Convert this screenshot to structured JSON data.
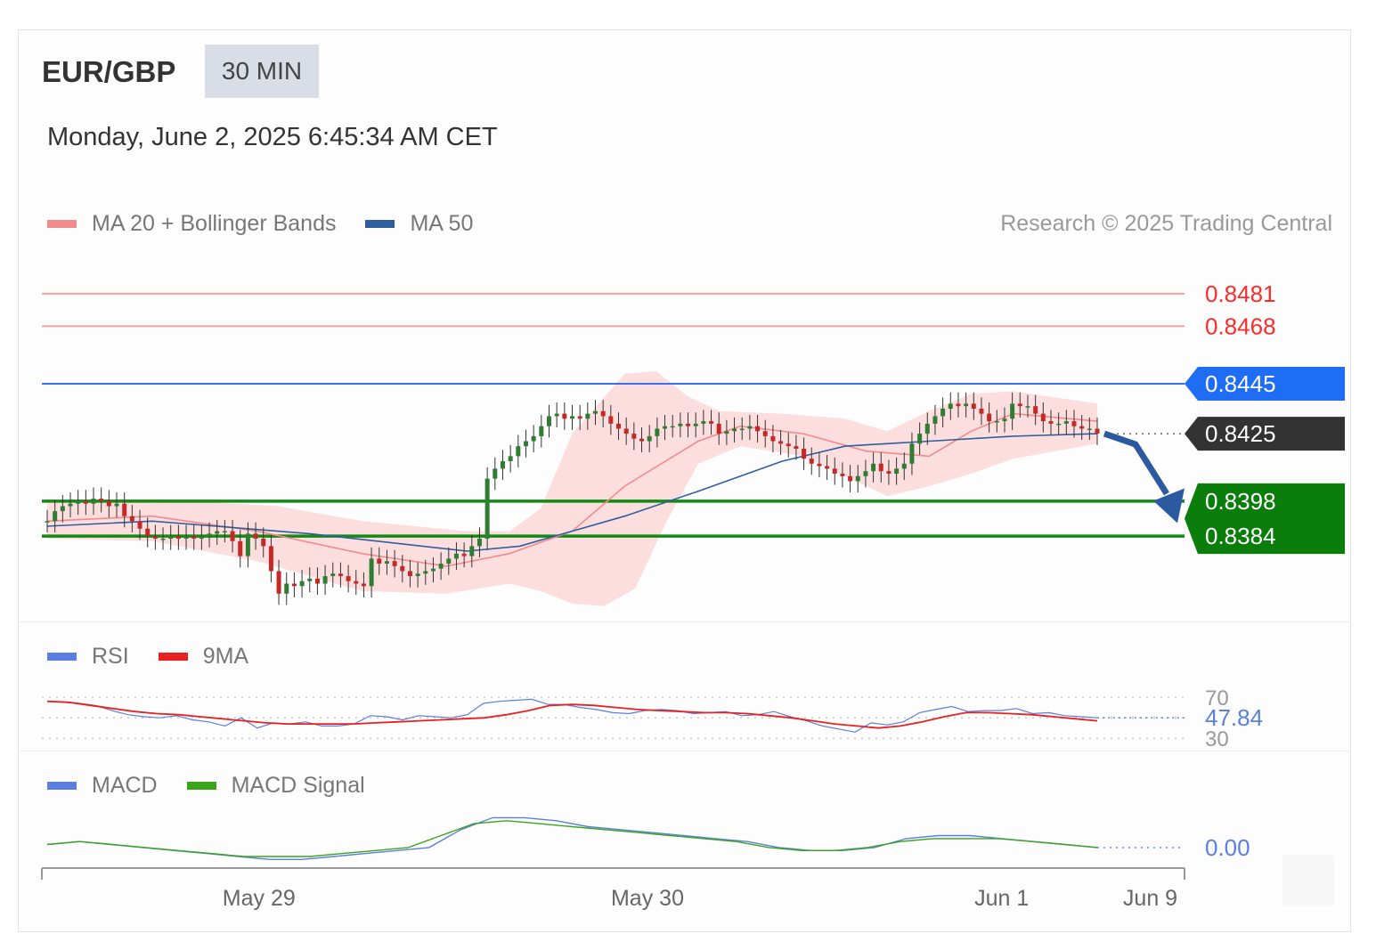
{
  "header": {
    "symbol": "EUR/GBP",
    "timeframe": "30 MIN",
    "datetime": "Monday, June 2, 2025 6:45:34 AM CET",
    "attribution": "Research © 2025 Trading Central"
  },
  "legends": {
    "price": [
      {
        "label": "MA 20 + Bollinger Bands",
        "color": "#f28b8b"
      },
      {
        "label": "MA 50",
        "color": "#2f5e9e"
      }
    ],
    "rsi": [
      {
        "label": "RSI",
        "color": "#5b7fe0"
      },
      {
        "label": "9MA",
        "color": "#e82020"
      }
    ],
    "macd": [
      {
        "label": "MACD",
        "color": "#5b7fe0"
      },
      {
        "label": "MACD Signal",
        "color": "#3aa41a"
      }
    ]
  },
  "chart_data": [
    {
      "type": "candlestick",
      "title": "",
      "y_range": [
        0.8352,
        0.8497
      ],
      "levels": [
        {
          "value": 0.8481,
          "label": "0.8481",
          "kind": "resistance",
          "color": "#ff2a2a",
          "line_color": "#f7a0a0",
          "tag_fill": "none"
        },
        {
          "value": 0.8468,
          "label": "0.8468",
          "kind": "resistance",
          "color": "#ff2a2a",
          "line_color": "#f7a0a0",
          "tag_fill": "none"
        },
        {
          "value": 0.8445,
          "label": "0.8445",
          "kind": "pivot",
          "color": "#ffffff",
          "line_color": "#3a6ff0",
          "tag_fill": "#1f6cf5"
        },
        {
          "value": 0.8425,
          "label": "0.8425",
          "kind": "last",
          "color": "#ffffff",
          "line_color": "#555555",
          "tag_fill": "#333333"
        },
        {
          "value": 0.8398,
          "label": "0.8398",
          "kind": "support",
          "color": "#ffffff",
          "line_color": "#138a13",
          "tag_fill": "#0a7d0a"
        },
        {
          "value": 0.8384,
          "label": "0.8384",
          "kind": "support",
          "color": "#ffffff",
          "line_color": "#138a13",
          "tag_fill": "#0a7d0a"
        }
      ],
      "candles_close": [
        0.839,
        0.8394,
        0.8396,
        0.8397,
        0.8398,
        0.8397,
        0.8399,
        0.8398,
        0.8396,
        0.8397,
        0.8392,
        0.839,
        0.8387,
        0.8384,
        0.8383,
        0.8383,
        0.8384,
        0.8383,
        0.8384,
        0.8383,
        0.8384,
        0.8385,
        0.8386,
        0.8386,
        0.8382,
        0.8376,
        0.8385,
        0.8383,
        0.838,
        0.837,
        0.8361,
        0.8365,
        0.8364,
        0.8366,
        0.8367,
        0.8365,
        0.8368,
        0.8369,
        0.8368,
        0.8366,
        0.8365,
        0.8364,
        0.8375,
        0.8373,
        0.8374,
        0.8372,
        0.837,
        0.8368,
        0.8369,
        0.837,
        0.8371,
        0.8373,
        0.8375,
        0.8377,
        0.8376,
        0.838,
        0.8383,
        0.8407,
        0.8411,
        0.8414,
        0.8416,
        0.842,
        0.8422,
        0.8424,
        0.8428,
        0.8432,
        0.8433,
        0.8431,
        0.8432,
        0.8431,
        0.8433,
        0.8434,
        0.8432,
        0.8429,
        0.8427,
        0.8425,
        0.8423,
        0.8422,
        0.8424,
        0.8427,
        0.8428,
        0.8428,
        0.8429,
        0.8428,
        0.8429,
        0.843,
        0.8429,
        0.8425,
        0.8426,
        0.8427,
        0.8427,
        0.8428,
        0.8426,
        0.8424,
        0.8422,
        0.8421,
        0.842,
        0.8419,
        0.8415,
        0.8413,
        0.8412,
        0.8411,
        0.8409,
        0.8408,
        0.8406,
        0.8408,
        0.841,
        0.8413,
        0.841,
        0.8409,
        0.8411,
        0.8413,
        0.8421,
        0.8425,
        0.8429,
        0.8432,
        0.8435,
        0.8437,
        0.8436,
        0.8437,
        0.8435,
        0.8433,
        0.843,
        0.843,
        0.8431,
        0.8437,
        0.8436,
        0.8436,
        0.8433,
        0.843,
        0.8429,
        0.8429,
        0.843,
        0.8428,
        0.8427,
        0.8427,
        0.8425
      ],
      "ma20": [
        [
          0.0,
          0.839
        ],
        [
          0.1,
          0.8392
        ],
        [
          0.2,
          0.8386
        ],
        [
          0.3,
          0.8377
        ],
        [
          0.38,
          0.8372
        ],
        [
          0.44,
          0.8377
        ],
        [
          0.5,
          0.8386
        ],
        [
          0.55,
          0.8404
        ],
        [
          0.62,
          0.8422
        ],
        [
          0.66,
          0.8428
        ],
        [
          0.72,
          0.8425
        ],
        [
          0.78,
          0.8418
        ],
        [
          0.84,
          0.8416
        ],
        [
          0.88,
          0.8426
        ],
        [
          0.92,
          0.8433
        ],
        [
          1.0,
          0.843
        ]
      ],
      "ma50": [
        [
          0.0,
          0.8388
        ],
        [
          0.1,
          0.839
        ],
        [
          0.25,
          0.8385
        ],
        [
          0.4,
          0.8378
        ],
        [
          0.45,
          0.838
        ],
        [
          0.55,
          0.8392
        ],
        [
          0.62,
          0.8402
        ],
        [
          0.7,
          0.8414
        ],
        [
          0.76,
          0.842
        ],
        [
          0.84,
          0.8422
        ],
        [
          0.92,
          0.8424
        ],
        [
          1.0,
          0.8425
        ]
      ],
      "bb_upper": [
        [
          0.0,
          0.8398
        ],
        [
          0.1,
          0.8399
        ],
        [
          0.22,
          0.8396
        ],
        [
          0.3,
          0.839
        ],
        [
          0.4,
          0.8386
        ],
        [
          0.44,
          0.8386
        ],
        [
          0.47,
          0.8395
        ],
        [
          0.5,
          0.8425
        ],
        [
          0.55,
          0.8449
        ],
        [
          0.58,
          0.845
        ],
        [
          0.61,
          0.844
        ],
        [
          0.64,
          0.8434
        ],
        [
          0.7,
          0.8433
        ],
        [
          0.76,
          0.8431
        ],
        [
          0.8,
          0.8426
        ],
        [
          0.84,
          0.8434
        ],
        [
          0.88,
          0.8441
        ],
        [
          0.92,
          0.8442
        ],
        [
          1.0,
          0.8437
        ]
      ],
      "bb_lower": [
        [
          0.0,
          0.8383
        ],
        [
          0.1,
          0.8382
        ],
        [
          0.2,
          0.8374
        ],
        [
          0.3,
          0.8362
        ],
        [
          0.38,
          0.8361
        ],
        [
          0.44,
          0.8365
        ],
        [
          0.47,
          0.8362
        ],
        [
          0.5,
          0.8357
        ],
        [
          0.53,
          0.8356
        ],
        [
          0.56,
          0.8363
        ],
        [
          0.59,
          0.839
        ],
        [
          0.62,
          0.8413
        ],
        [
          0.66,
          0.842
        ],
        [
          0.72,
          0.8416
        ],
        [
          0.76,
          0.8408
        ],
        [
          0.8,
          0.84
        ],
        [
          0.84,
          0.8404
        ],
        [
          0.88,
          0.8409
        ],
        [
          0.92,
          0.8415
        ],
        [
          1.0,
          0.8421
        ]
      ]
    },
    {
      "type": "line",
      "title": "",
      "y_range": [
        25,
        90
      ],
      "reference_lines": [
        70,
        50,
        30
      ],
      "reference_labels": [
        "70",
        "30"
      ],
      "last_value_label": "47.84",
      "series": [
        {
          "name": "RSI",
          "values": [
            66,
            65,
            64,
            62,
            57,
            53,
            51,
            50,
            52,
            48,
            46,
            42,
            50,
            40,
            45,
            44,
            46,
            42,
            42,
            44,
            52,
            51,
            48,
            52,
            51,
            50,
            53,
            64,
            66,
            67,
            68,
            63,
            63,
            60,
            58,
            55,
            54,
            57,
            58,
            57,
            54,
            55,
            56,
            52,
            53,
            56,
            51,
            47,
            42,
            39,
            36,
            45,
            43,
            46,
            55,
            58,
            61,
            56,
            57,
            57,
            59,
            54,
            55,
            52,
            51,
            50
          ]
        },
        {
          "name": "9MA",
          "values": [
            66,
            65,
            62,
            59,
            56,
            54,
            53,
            51,
            49,
            47,
            45,
            44,
            44,
            44,
            44,
            45,
            46,
            47,
            48,
            49,
            50,
            53,
            57,
            62,
            63,
            62,
            60,
            58,
            57,
            56,
            55,
            55,
            54,
            52,
            50,
            47,
            44,
            42,
            40,
            42,
            46,
            51,
            55,
            55,
            54,
            53,
            51,
            49,
            47
          ]
        }
      ]
    },
    {
      "type": "line",
      "title": "",
      "y_range": [
        -0.0006,
        0.0014
      ],
      "zero_label": "0.00",
      "series": [
        {
          "name": "MACD",
          "values": [
            0.0001,
            0.0002,
            0.0001,
            0.0,
            -0.0001,
            -0.0002,
            -0.0003,
            -0.0004,
            -0.0004,
            -0.0003,
            -0.0002,
            -0.0001,
            0.0,
            0.0006,
            0.001,
            0.001,
            0.0009,
            0.0007,
            0.0006,
            0.0005,
            0.0004,
            0.0003,
            0.0002,
            0.0,
            -0.0001,
            -0.0001,
            0.0,
            0.0003,
            0.0004,
            0.0004,
            0.0003,
            0.0002,
            0.0001,
            0.0
          ]
        },
        {
          "name": "MACD Signal",
          "values": [
            0.0001,
            0.0002,
            0.0001,
            0.0,
            -0.0001,
            -0.0002,
            -0.0003,
            -0.0003,
            -0.0003,
            -0.0002,
            -0.0001,
            0.0,
            0.0004,
            0.0008,
            0.0009,
            0.0008,
            0.0007,
            0.0006,
            0.0005,
            0.0004,
            0.0003,
            0.0002,
            0.0,
            -0.0001,
            -0.0001,
            0.0,
            0.0002,
            0.0003,
            0.0003,
            0.0003,
            0.0002,
            0.0001,
            0.0
          ]
        }
      ]
    }
  ],
  "x_axis": {
    "ticks": [
      "May 29",
      "May 30",
      "Jun 1",
      "Jun 9"
    ],
    "tick_positions": [
      0.19,
      0.53,
      0.84,
      0.97
    ]
  }
}
